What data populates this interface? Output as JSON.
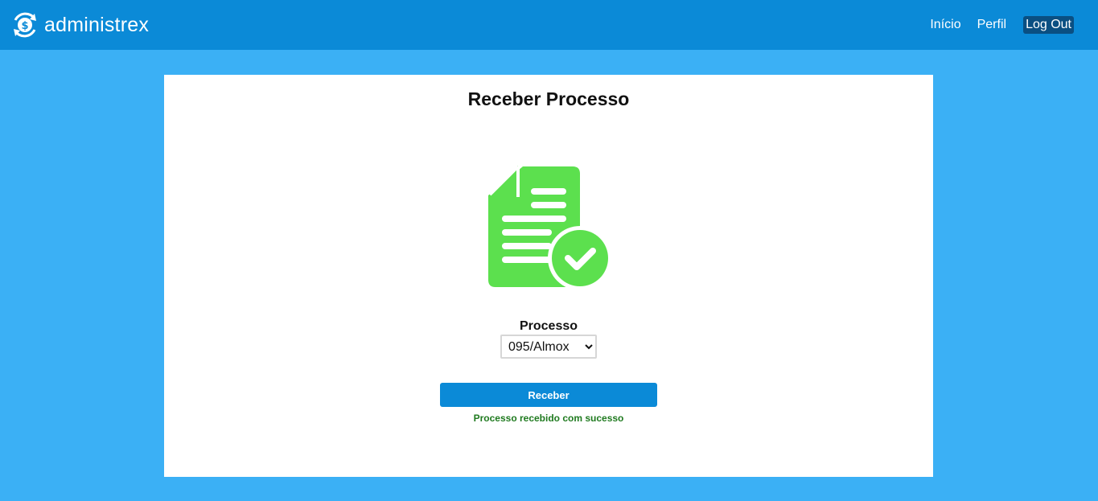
{
  "brand": {
    "name": "administrex",
    "logo_icon": "dollar-cycle-icon"
  },
  "nav": {
    "items": [
      {
        "label": "Início"
      },
      {
        "label": "Perfil"
      },
      {
        "label": "Log Out"
      }
    ]
  },
  "main": {
    "title": "Receber Processo",
    "illustration_icon": "document-check-icon",
    "field_label": "Processo",
    "select": {
      "selected": "095/Almox",
      "options": [
        "095/Almox"
      ]
    },
    "submit_label": "Receber",
    "status_message": "Processo recebido com sucesso"
  },
  "colors": {
    "navbar": "#0b8ad7",
    "background": "#3bb0f5",
    "logout_bg": "#0a4f82",
    "icon_green": "#5ce04e",
    "success_text": "#1f7a1f"
  }
}
